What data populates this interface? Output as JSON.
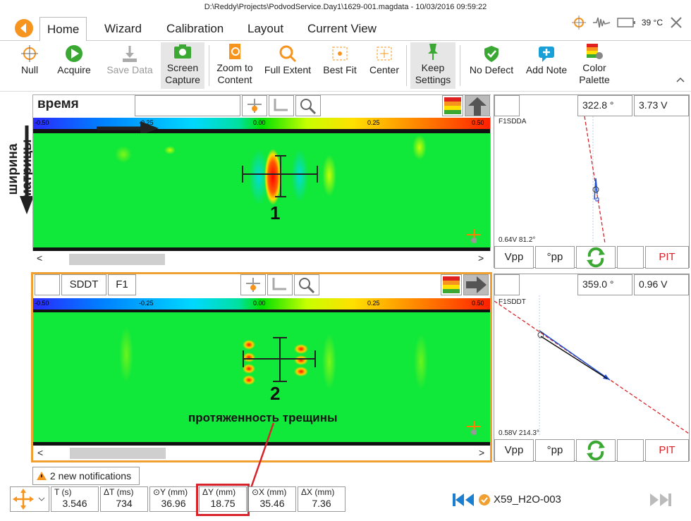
{
  "window": {
    "title": "D:\\Reddy\\Projects\\PodvodService.Day1\\1629-001.magdata - 10/03/2016 09:59:22",
    "temp": "39 °C"
  },
  "tabs": [
    "Home",
    "Wizard",
    "Calibration",
    "Layout",
    "Current View"
  ],
  "ribbon": {
    "null": "Null",
    "acquire": "Acquire",
    "save": "Save Data",
    "screen": "Screen\nCapture",
    "zoom": "Zoom to\nContent",
    "full": "Full Extent",
    "best": "Best Fit",
    "center": "Center",
    "keep": "Keep\nSettings",
    "nodefect": "No Defect",
    "addnote": "Add Note",
    "palette": "Color\nPalette"
  },
  "top": {
    "label": "время",
    "scale": [
      "-0.50",
      "-0.25",
      "0.00",
      "0.25",
      "0.50"
    ],
    "marker": "1",
    "side_label": "ширина матрицы",
    "side_angle": "322.8 °",
    "side_volt": "3.73 V",
    "side_channel": "F1SDDA",
    "side_reading": "0.64V 81.2°"
  },
  "bottom": {
    "fields": [
      "SDDT",
      "F1"
    ],
    "scale": [
      "-0.50",
      "-0.25",
      "0.00",
      "0.25",
      "0.50"
    ],
    "marker": "2",
    "annotation": "протяженность трещины",
    "side_angle": "359.0 °",
    "side_volt": "0.96 V",
    "side_channel": "F1SDDT",
    "side_reading": "0.58V 214.3°"
  },
  "pbtns": {
    "vpp": "Vpp",
    "pp": "°pp",
    "pit": "PIT"
  },
  "notifications": "2 new notifications",
  "stats": [
    {
      "l": "T (s)",
      "v": "3.546"
    },
    {
      "l": "ΔT (ms)",
      "v": "734"
    },
    {
      "l": "⊙Y (mm)",
      "v": "36.96"
    },
    {
      "l": "ΔY (mm)",
      "v": "18.75"
    },
    {
      "l": "⊙X (mm)",
      "v": "35.46"
    },
    {
      "l": "ΔX (mm)",
      "v": "7.36"
    }
  ],
  "file": "X59_H2O-003",
  "colors": {
    "accent": "#f7941d",
    "green": "#10e83a",
    "highlight": "#d8232a"
  }
}
